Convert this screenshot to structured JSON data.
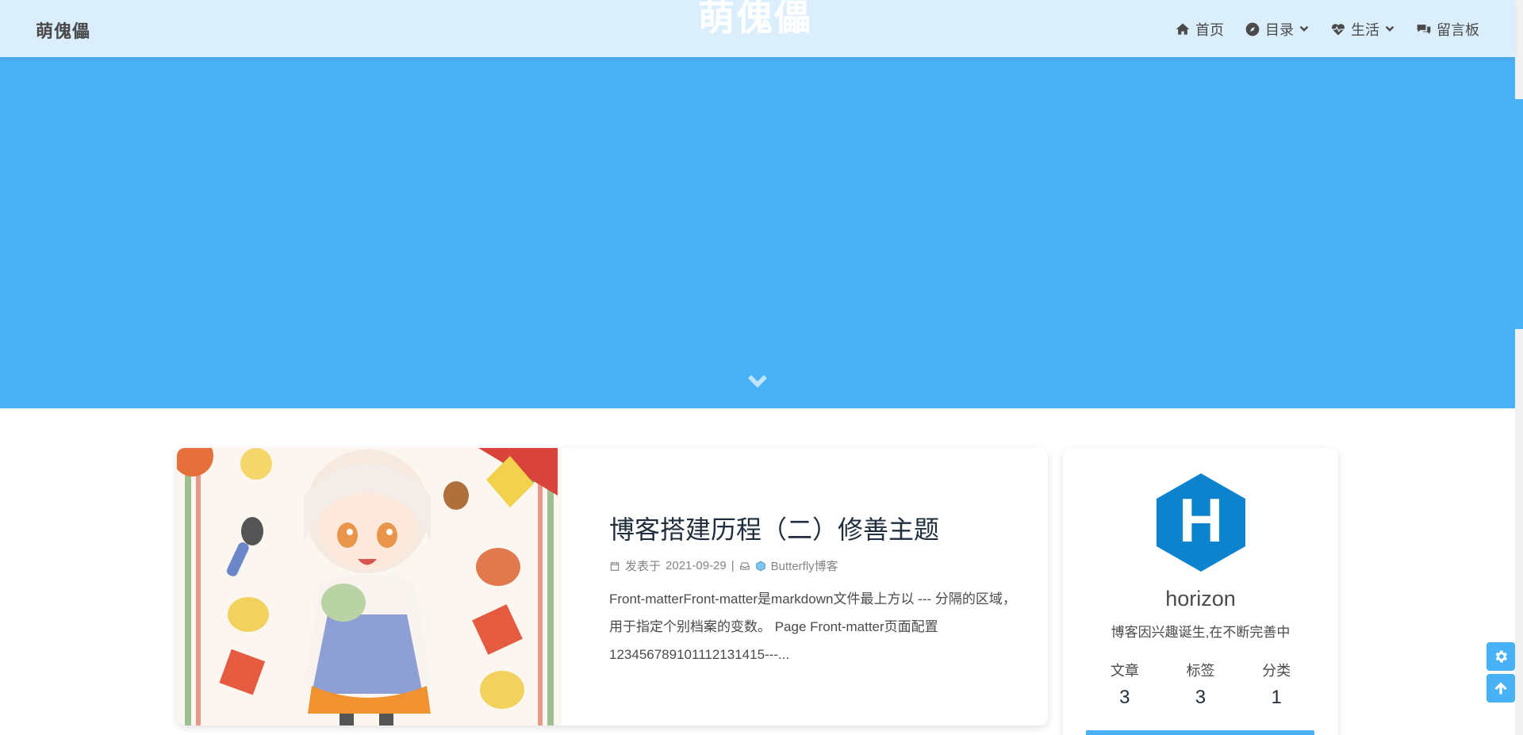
{
  "site": {
    "brand": "萌傀儡",
    "hero_title": "萌傀儡"
  },
  "nav": {
    "items": [
      {
        "label": "首页",
        "icon": "home-icon",
        "dropdown": false
      },
      {
        "label": "目录",
        "icon": "compass-icon",
        "dropdown": true
      },
      {
        "label": "生活",
        "icon": "heartbeat-icon",
        "dropdown": true
      },
      {
        "label": "留言板",
        "icon": "comments-icon",
        "dropdown": false
      }
    ]
  },
  "colors": {
    "banner": "#49b1f5",
    "navbar": "#dbeefc",
    "accent": "#49b1f5"
  },
  "post": {
    "title": "博客搭建历程（二）修善主题",
    "date_prefix": "发表于",
    "date": "2021-09-29",
    "separator": "|",
    "category": "Butterfly博客",
    "excerpt": "Front-matterFront-matter是markdown文件最上方以 --- 分隔的区域，用于指定个别档案的变数。 Page Front-matter页面配置 123456789101112131415---..."
  },
  "author": {
    "avatar_letter": "H",
    "name": "horizon",
    "description": "博客因兴趣诞生,在不断完善中",
    "stats": [
      {
        "label": "文章",
        "value": "3"
      },
      {
        "label": "标签",
        "value": "3"
      },
      {
        "label": "分类",
        "value": "1"
      }
    ]
  },
  "rightside": {
    "settings_icon": "gear-icon",
    "top_icon": "arrow-up-icon"
  }
}
